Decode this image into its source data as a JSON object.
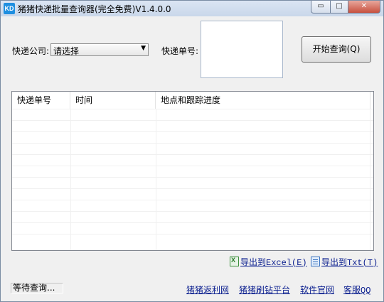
{
  "window": {
    "icon_text": "KD",
    "title": "猪猪快递批量查询器(完全免费)V1.4.0.0",
    "controls": {
      "minimize": "▭",
      "maximize": "□",
      "close": "✕"
    }
  },
  "form": {
    "company_label": "快递公司:",
    "company_value": "请选择",
    "tracking_label": "快递单号:",
    "tracking_value": "",
    "query_button": "开始查询(Q)"
  },
  "table": {
    "columns": [
      "快递单号",
      "时间",
      "地点和跟踪进度"
    ],
    "rows": []
  },
  "export": {
    "excel_label": "导出到Excel(E)",
    "txt_label": "导出到Txt(T)"
  },
  "status": "等待查询...",
  "links": [
    "猪猪返利网",
    "猪猪刷钻平台",
    "软件官网",
    "客服QQ"
  ]
}
